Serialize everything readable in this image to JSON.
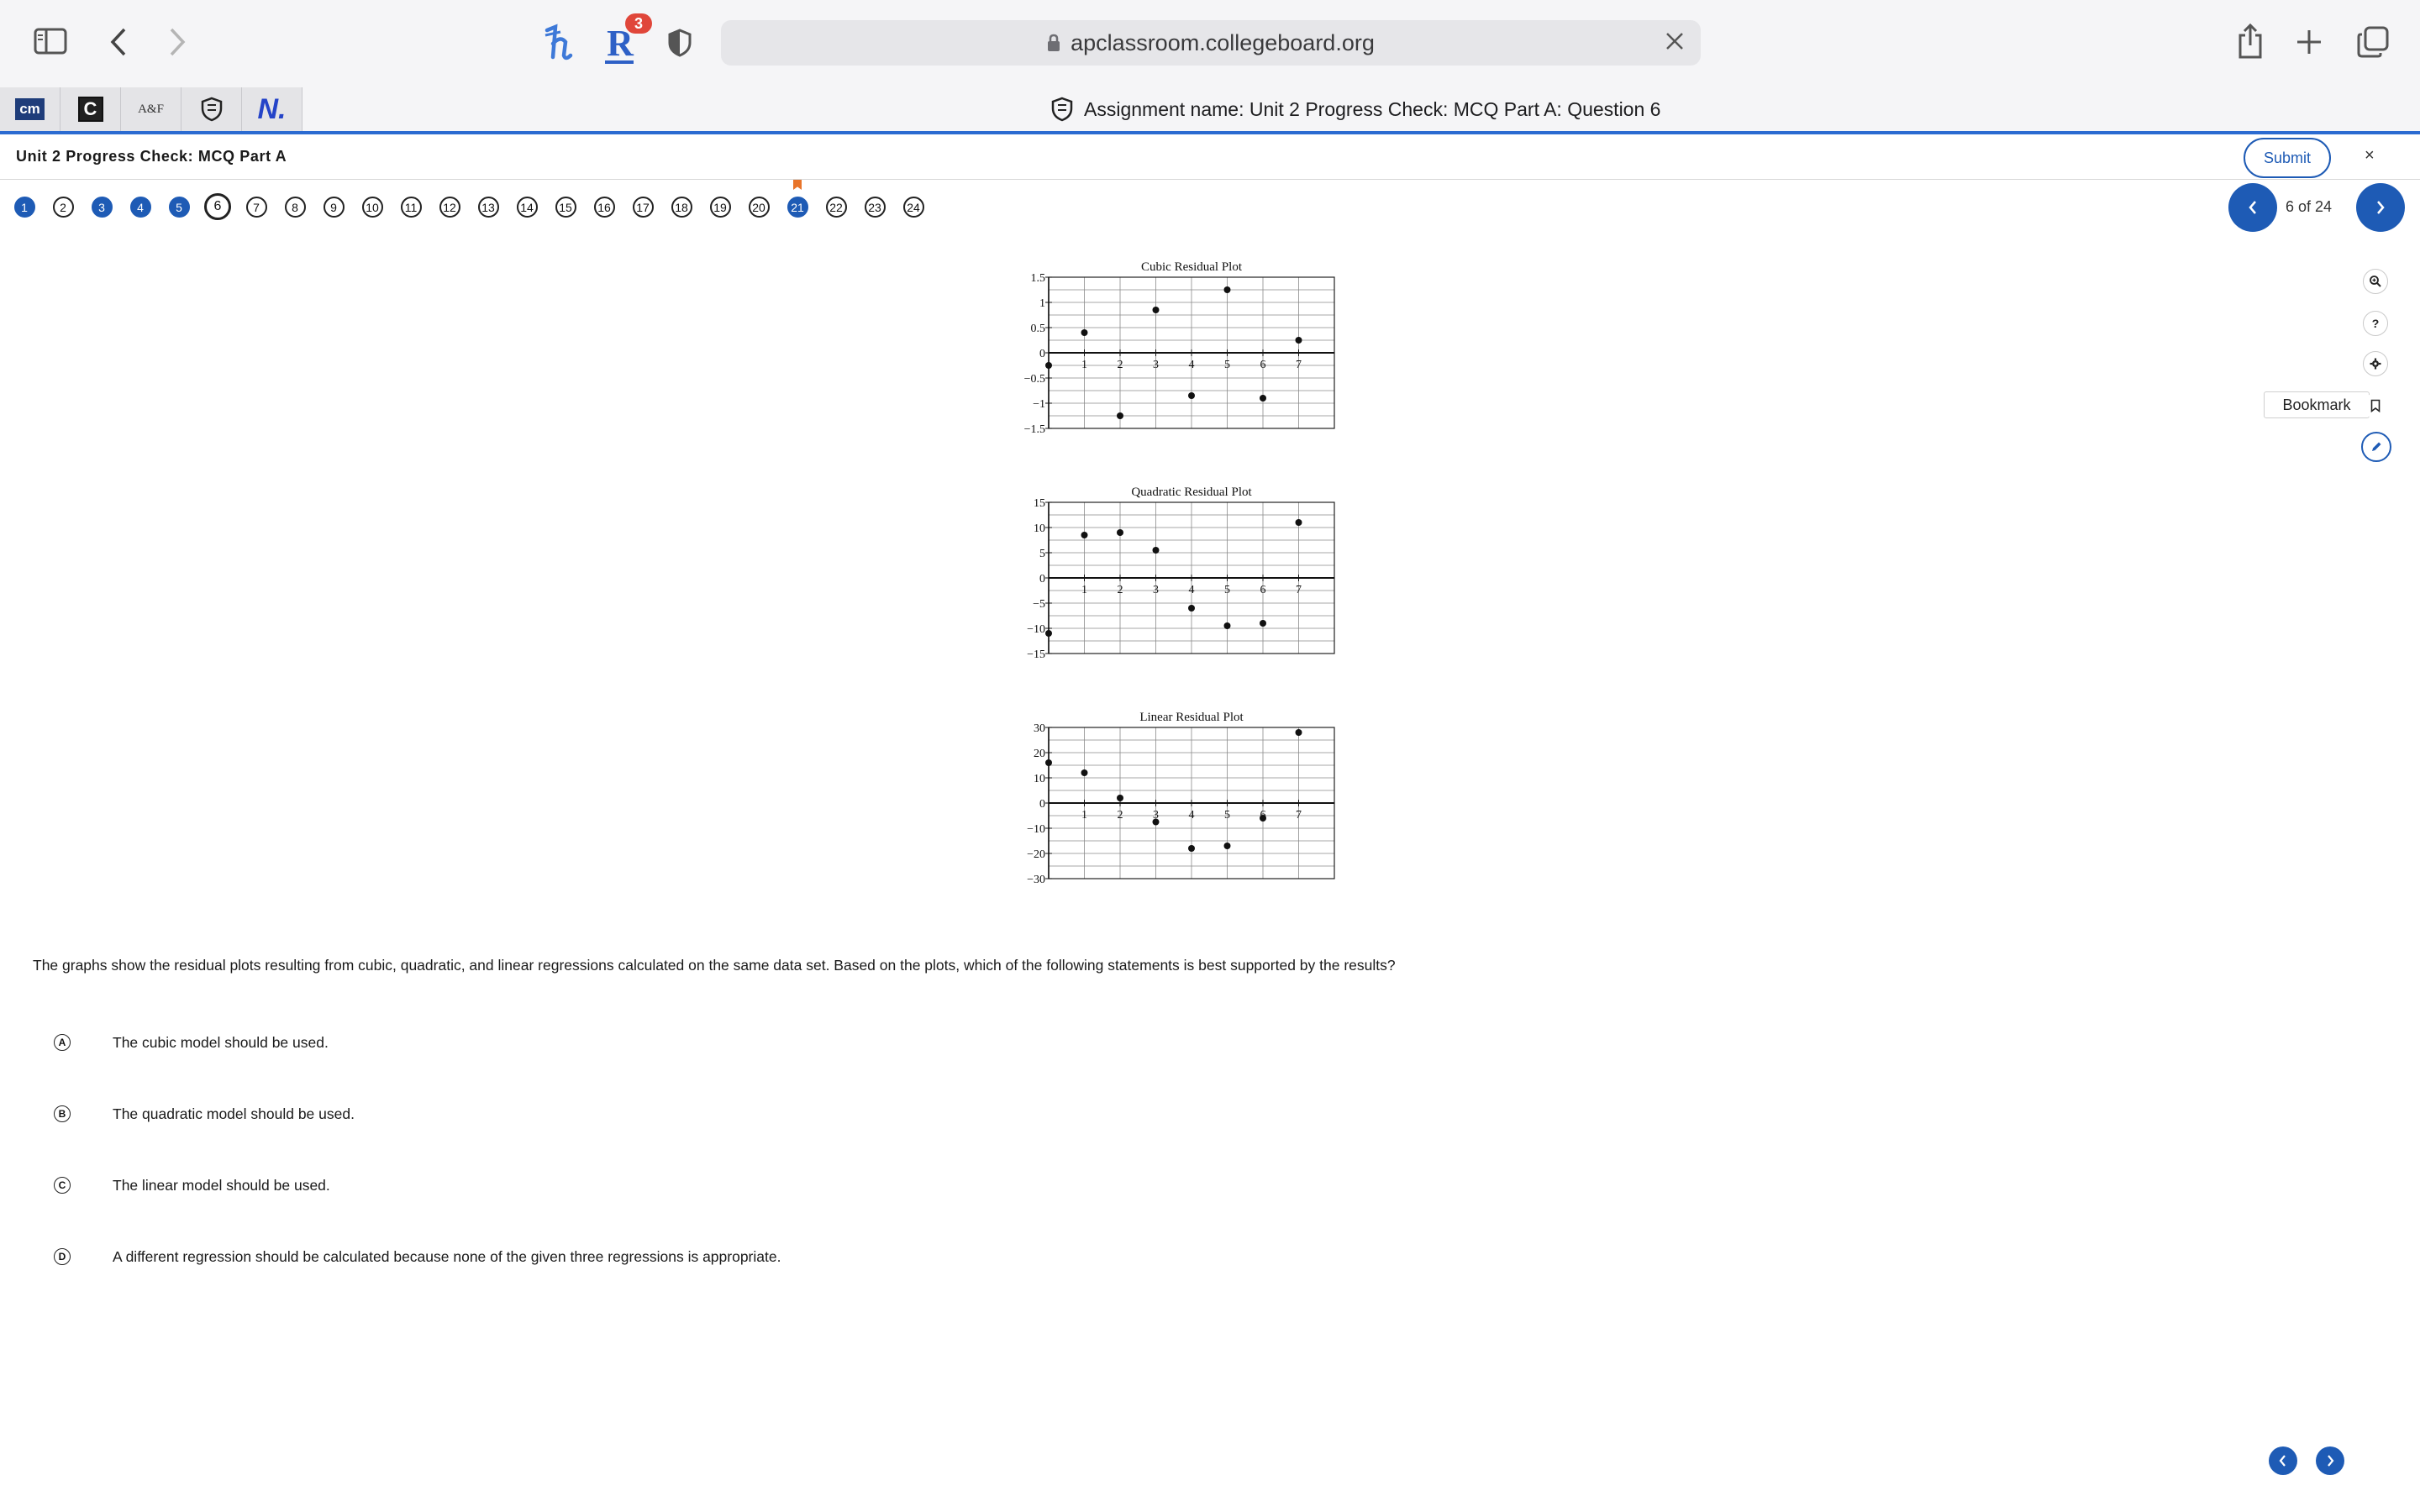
{
  "browser": {
    "url": "apclassroom.collegeboard.org",
    "badge_count": "3"
  },
  "extensions": [
    {
      "name": "cm",
      "label": "cm"
    },
    {
      "name": "c",
      "label": "C"
    },
    {
      "name": "af",
      "label": "A&F"
    },
    {
      "name": "shield",
      "label": ""
    },
    {
      "name": "n",
      "label": "N."
    }
  ],
  "assignment": {
    "title": "Assignment name: Unit 2 Progress Check: MCQ Part A: Question 6"
  },
  "header": {
    "unit_title": "Unit 2 Progress Check: MCQ Part A",
    "submit_label": "Submit",
    "close_label": "×"
  },
  "nav": {
    "questions": [
      {
        "num": "1",
        "state": "answered"
      },
      {
        "num": "2",
        "state": "unanswered"
      },
      {
        "num": "3",
        "state": "answered"
      },
      {
        "num": "4",
        "state": "answered"
      },
      {
        "num": "5",
        "state": "answered"
      },
      {
        "num": "6",
        "state": "current"
      },
      {
        "num": "7",
        "state": "unanswered"
      },
      {
        "num": "8",
        "state": "unanswered"
      },
      {
        "num": "9",
        "state": "unanswered"
      },
      {
        "num": "10",
        "state": "unanswered"
      },
      {
        "num": "11",
        "state": "unanswered"
      },
      {
        "num": "12",
        "state": "unanswered"
      },
      {
        "num": "13",
        "state": "unanswered"
      },
      {
        "num": "14",
        "state": "unanswered"
      },
      {
        "num": "15",
        "state": "unanswered"
      },
      {
        "num": "16",
        "state": "unanswered"
      },
      {
        "num": "17",
        "state": "unanswered"
      },
      {
        "num": "18",
        "state": "unanswered"
      },
      {
        "num": "19",
        "state": "unanswered"
      },
      {
        "num": "20",
        "state": "unanswered"
      },
      {
        "num": "21",
        "state": "answered-bookmarked"
      },
      {
        "num": "22",
        "state": "unanswered"
      },
      {
        "num": "23",
        "state": "unanswered"
      },
      {
        "num": "24",
        "state": "unanswered"
      }
    ],
    "page_count": "6 of 24"
  },
  "tools": {
    "bookmark_label": "Bookmark",
    "help_label": "?"
  },
  "chart_data": [
    {
      "type": "scatter",
      "title": "Cubic Residual Plot",
      "xlabel": "",
      "ylabel": "",
      "x_ticks": [
        "1",
        "2",
        "3",
        "4",
        "5",
        "6",
        "7"
      ],
      "y_ticks": [
        "1.5",
        "1",
        "0.5",
        "0",
        "−0.5",
        "−1",
        "−1.5"
      ],
      "xlim": [
        0,
        8
      ],
      "ylim": [
        -1.5,
        1.5
      ],
      "grid": true,
      "points": [
        {
          "x": 0,
          "y": -0.25
        },
        {
          "x": 1,
          "y": 0.4
        },
        {
          "x": 2,
          "y": -1.25
        },
        {
          "x": 3,
          "y": 0.85
        },
        {
          "x": 4,
          "y": -0.85
        },
        {
          "x": 5,
          "y": 1.25
        },
        {
          "x": 6,
          "y": -0.9
        },
        {
          "x": 7,
          "y": 0.25
        }
      ]
    },
    {
      "type": "scatter",
      "title": "Quadratic Residual Plot",
      "xlabel": "",
      "ylabel": "",
      "x_ticks": [
        "1",
        "2",
        "3",
        "4",
        "5",
        "6",
        "7"
      ],
      "y_ticks": [
        "15",
        "10",
        "5",
        "0",
        "−5",
        "−10",
        "−15"
      ],
      "xlim": [
        0,
        8
      ],
      "ylim": [
        -15,
        15
      ],
      "grid": true,
      "points": [
        {
          "x": 0,
          "y": -11
        },
        {
          "x": 1,
          "y": 8.5
        },
        {
          "x": 2,
          "y": 9
        },
        {
          "x": 3,
          "y": 5.5
        },
        {
          "x": 4,
          "y": -6
        },
        {
          "x": 5,
          "y": -9.5
        },
        {
          "x": 6,
          "y": -9
        },
        {
          "x": 7,
          "y": 11
        }
      ]
    },
    {
      "type": "scatter",
      "title": "Linear Residual Plot",
      "xlabel": "",
      "ylabel": "",
      "x_ticks": [
        "1",
        "2",
        "3",
        "4",
        "5",
        "6",
        "7"
      ],
      "y_ticks": [
        "30",
        "20",
        "10",
        "0",
        "−10",
        "−20",
        "−30"
      ],
      "xlim": [
        0,
        8
      ],
      "ylim": [
        -30,
        30
      ],
      "grid": true,
      "points": [
        {
          "x": 0,
          "y": 16
        },
        {
          "x": 1,
          "y": 12
        },
        {
          "x": 2,
          "y": 2
        },
        {
          "x": 3,
          "y": -7.5
        },
        {
          "x": 4,
          "y": -18
        },
        {
          "x": 5,
          "y": -17
        },
        {
          "x": 6,
          "y": -6
        },
        {
          "x": 7,
          "y": 28
        }
      ]
    }
  ],
  "question": {
    "text": "The graphs show the residual plots resulting from cubic, quadratic, and linear regressions calculated on the same data set. Based on the plots, which of the following statements is best supported by the results?",
    "choices": [
      {
        "letter": "A",
        "text": "The cubic model should be used."
      },
      {
        "letter": "B",
        "text": "The quadratic model should be used."
      },
      {
        "letter": "C",
        "text": "The linear model should be used."
      },
      {
        "letter": "D",
        "text": "A different regression should be calculated because none of the given three regressions is appropriate."
      }
    ]
  },
  "colors": {
    "accent": "#1e5bb5",
    "tab_underline": "#2b6bd1",
    "bookmark_flag": "#e8742a",
    "badge": "#e0463a"
  }
}
